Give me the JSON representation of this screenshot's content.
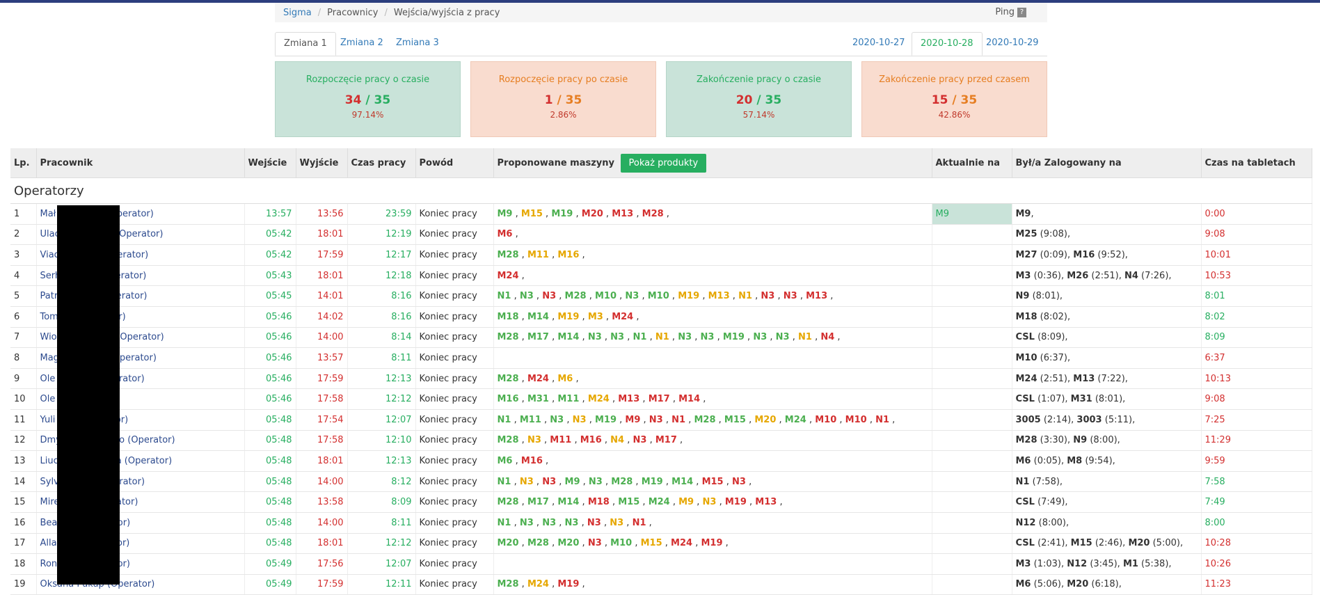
{
  "breadcrumb": {
    "items": [
      "Sigma",
      "Pracownicy",
      "Wejścia/wyjścia z pracy"
    ],
    "ping": "Ping",
    "ping_q": "?"
  },
  "tabs": {
    "shifts": [
      "Zmiana 1",
      "Zmiana 2",
      "Zmiana 3"
    ],
    "dates": [
      "2020-10-27",
      "2020-10-28",
      "2020-10-29"
    ]
  },
  "stats": [
    {
      "title": "Rozpoczęcie pracy o czasie",
      "num": "34",
      "sep": " / ",
      "total": "35",
      "pct": "97.14%"
    },
    {
      "title": "Rozpoczęcie pracy po czasie",
      "num": "1",
      "sep": " / ",
      "total": "35",
      "pct": "2.86%"
    },
    {
      "title": "Zakończenie pracy o czasie",
      "num": "20",
      "sep": " / ",
      "total": "35",
      "pct": "57.14%"
    },
    {
      "title": "Zakończenie pracy przed czasem",
      "num": "15",
      "sep": " / ",
      "total": "35",
      "pct": "42.86%"
    }
  ],
  "table": {
    "headers": [
      "Lp.",
      "Pracownik",
      "Wejście",
      "Wyjście",
      "Czas pracy",
      "Powód",
      "Proponowane maszyny",
      "Aktualnie na",
      "Był/a Zalogowany na",
      "Czas na tabletach"
    ],
    "button": "Pokaż produkty",
    "group": "Operatorzy",
    "rows": [
      {
        "lp": "1",
        "emp": "Mał",
        "emp2": "a (Operator)",
        "in": "13:57",
        "out": "13:56",
        "time": "23:59",
        "reason": "Koniec pracy",
        "m": [
          [
            "M9",
            "g"
          ],
          [
            "M15",
            "y"
          ],
          [
            "M19",
            "g"
          ],
          [
            "M20",
            "r"
          ],
          [
            "M13",
            "r"
          ],
          [
            "M28",
            "r"
          ]
        ],
        "curr": "M9",
        "log": "M9,",
        "tab": "0:00",
        "tabc": "red"
      },
      {
        "lp": "2",
        "emp": "Ulac",
        "emp2": "da (Operator)",
        "in": "05:42",
        "out": "18:01",
        "time": "12:19",
        "reason": "Koniec pracy",
        "m": [
          [
            "M6",
            "r"
          ]
        ],
        "curr": "",
        "log": "M25 (9:08),",
        "tab": "9:08",
        "tabc": "red"
      },
      {
        "lp": "3",
        "emp": "Viac",
        "emp2": "(Operator)",
        "in": "05:42",
        "out": "17:59",
        "time": "12:17",
        "reason": "Koniec pracy",
        "m": [
          [
            "M28",
            "g"
          ],
          [
            "M11",
            "y"
          ],
          [
            "M16",
            "y"
          ]
        ],
        "curr": "",
        "log": "M27 (0:09), M16 (9:52),",
        "tab": "10:01",
        "tabc": "red"
      },
      {
        "lp": "4",
        "emp": "Serh",
        "emp2": "Operator)",
        "in": "05:43",
        "out": "18:01",
        "time": "12:18",
        "reason": "Koniec pracy",
        "m": [
          [
            "M24",
            "r"
          ]
        ],
        "curr": "",
        "log": "M3 (0:36), M26 (2:51), N4 (7:26),",
        "tab": "10:53",
        "tabc": "red"
      },
      {
        "lp": "5",
        "emp": "Patr",
        "emp2": "(Operator)",
        "in": "05:45",
        "out": "14:01",
        "time": "8:16",
        "reason": "Koniec pracy",
        "m": [
          [
            "N1",
            "g"
          ],
          [
            "N3",
            "g"
          ],
          [
            "N3",
            "r"
          ],
          [
            "M28",
            "g"
          ],
          [
            "M10",
            "g"
          ],
          [
            "N3",
            "g"
          ],
          [
            "M10",
            "g"
          ],
          [
            "M19",
            "y"
          ],
          [
            "M13",
            "y"
          ],
          [
            "N1",
            "y"
          ],
          [
            "N3",
            "r"
          ],
          [
            "N3",
            "r"
          ],
          [
            "M13",
            "r"
          ]
        ],
        "curr": "",
        "log": "N9 (8:01),",
        "tab": "8:01",
        "tabc": "grn"
      },
      {
        "lp": "6",
        "emp": "Tom",
        "emp2": "rator)",
        "in": "05:46",
        "out": "14:02",
        "time": "8:16",
        "reason": "Koniec pracy",
        "m": [
          [
            "M18",
            "g"
          ],
          [
            "M14",
            "g"
          ],
          [
            "M19",
            "y"
          ],
          [
            "M3",
            "y"
          ],
          [
            "M24",
            "r"
          ]
        ],
        "curr": "",
        "log": "M18 (8:02),",
        "tab": "8:02",
        "tabc": "grn"
      },
      {
        "lp": "7",
        "emp": "Wio",
        "emp2": "ura (Operator)",
        "in": "05:46",
        "out": "14:00",
        "time": "8:14",
        "reason": "Koniec pracy",
        "m": [
          [
            "M28",
            "g"
          ],
          [
            "M17",
            "g"
          ],
          [
            "M14",
            "g"
          ],
          [
            "N3",
            "g"
          ],
          [
            "N3",
            "g"
          ],
          [
            "N1",
            "g"
          ],
          [
            "N1",
            "y"
          ],
          [
            "N3",
            "g"
          ],
          [
            "N3",
            "g"
          ],
          [
            "M19",
            "g"
          ],
          [
            "N3",
            "g"
          ],
          [
            "N3",
            "g"
          ],
          [
            "N1",
            "y"
          ],
          [
            "N4",
            "r"
          ]
        ],
        "curr": "",
        "log": "CSL (8:09),",
        "tab": "8:09",
        "tabc": "grn"
      },
      {
        "lp": "8",
        "emp": "Mag",
        "emp2": "k (Operator)",
        "in": "05:46",
        "out": "13:57",
        "time": "8:11",
        "reason": "Koniec pracy",
        "m": [],
        "curr": "",
        "log": "M10 (6:37),",
        "tab": "6:37",
        "tabc": "red"
      },
      {
        "lp": "9",
        "emp": "Ole",
        "emp2": "(Operator)",
        "in": "05:46",
        "out": "17:59",
        "time": "12:13",
        "reason": "Koniec pracy",
        "m": [
          [
            "M28",
            "g"
          ],
          [
            "M24",
            "r"
          ],
          [
            "M6",
            "y"
          ]
        ],
        "curr": "",
        "log": "M24 (2:51), M13 (7:22),",
        "tab": "10:13",
        "tabc": "red"
      },
      {
        "lp": "10",
        "emp": "Ole",
        "emp2": "tor)",
        "in": "05:46",
        "out": "17:58",
        "time": "12:12",
        "reason": "Koniec pracy",
        "m": [
          [
            "M16",
            "g"
          ],
          [
            "M31",
            "g"
          ],
          [
            "M11",
            "g"
          ],
          [
            "M24",
            "y"
          ],
          [
            "M13",
            "r"
          ],
          [
            "M17",
            "r"
          ],
          [
            "M14",
            "r"
          ]
        ],
        "curr": "",
        "log": "CSL (1:07), M31 (8:01),",
        "tab": "9:08",
        "tabc": "red"
      },
      {
        "lp": "11",
        "emp": "Yuli",
        "emp2": "erator)",
        "in": "05:48",
        "out": "17:54",
        "time": "12:07",
        "reason": "Koniec pracy",
        "m": [
          [
            "N1",
            "g"
          ],
          [
            "M11",
            "g"
          ],
          [
            "N3",
            "g"
          ],
          [
            "N3",
            "y"
          ],
          [
            "M19",
            "g"
          ],
          [
            "M9",
            "r"
          ],
          [
            "N3",
            "r"
          ],
          [
            "N1",
            "r"
          ],
          [
            "M28",
            "g"
          ],
          [
            "M15",
            "g"
          ],
          [
            "M20",
            "y"
          ],
          [
            "M24",
            "g"
          ],
          [
            "M10",
            "r"
          ],
          [
            "M10",
            "r"
          ],
          [
            "N1",
            "r"
          ]
        ],
        "curr": "",
        "log": "3005 (2:14), 3003 (5:11),",
        "tab": "7:25",
        "tabc": "red"
      },
      {
        "lp": "12",
        "emp": "Dmy",
        "emp2": "enko (Operator)",
        "in": "05:48",
        "out": "17:58",
        "time": "12:10",
        "reason": "Koniec pracy",
        "m": [
          [
            "M28",
            "g"
          ],
          [
            "N3",
            "y"
          ],
          [
            "M11",
            "r"
          ],
          [
            "M16",
            "r"
          ],
          [
            "N4",
            "y"
          ],
          [
            "N3",
            "r"
          ],
          [
            "M17",
            "r"
          ]
        ],
        "curr": "",
        "log": "M28 (3:30), N9 (8:00),",
        "tab": "11:29",
        "tabc": "red"
      },
      {
        "lp": "13",
        "emp": "Liuc",
        "emp2": "kaya (Operator)",
        "in": "05:48",
        "out": "18:01",
        "time": "12:13",
        "reason": "Koniec pracy",
        "m": [
          [
            "M6",
            "g"
          ],
          [
            "M16",
            "r"
          ]
        ],
        "curr": "",
        "log": "M6 (0:05), M8 (9:54),",
        "tab": "9:59",
        "tabc": "red"
      },
      {
        "lp": "14",
        "emp": "Sylv",
        "emp2": "Operator)",
        "in": "05:48",
        "out": "14:00",
        "time": "8:12",
        "reason": "Koniec pracy",
        "m": [
          [
            "N1",
            "g"
          ],
          [
            "N3",
            "y"
          ],
          [
            "N3",
            "r"
          ],
          [
            "M9",
            "g"
          ],
          [
            "N3",
            "g"
          ],
          [
            "M28",
            "g"
          ],
          [
            "M19",
            "g"
          ],
          [
            "M14",
            "g"
          ],
          [
            "M15",
            "r"
          ],
          [
            "N3",
            "r"
          ]
        ],
        "curr": "",
        "log": "N1 (7:58),",
        "tab": "7:58",
        "tabc": "grn"
      },
      {
        "lp": "15",
        "emp": "Mire",
        "emp2": "perator)",
        "in": "05:48",
        "out": "13:58",
        "time": "8:09",
        "reason": "Koniec pracy",
        "m": [
          [
            "M28",
            "g"
          ],
          [
            "M17",
            "g"
          ],
          [
            "M14",
            "g"
          ],
          [
            "M18",
            "r"
          ],
          [
            "M15",
            "g"
          ],
          [
            "M24",
            "g"
          ],
          [
            "M9",
            "y"
          ],
          [
            "N3",
            "y"
          ],
          [
            "M19",
            "r"
          ],
          [
            "M13",
            "r"
          ]
        ],
        "curr": "",
        "log": "CSL (7:49),",
        "tab": "7:49",
        "tabc": "grn"
      },
      {
        "lp": "16",
        "emp": "Bea",
        "emp2": "erator)",
        "in": "05:48",
        "out": "14:00",
        "time": "8:11",
        "reason": "Koniec pracy",
        "m": [
          [
            "N1",
            "g"
          ],
          [
            "N3",
            "g"
          ],
          [
            "N3",
            "g"
          ],
          [
            "N3",
            "g"
          ],
          [
            "N3",
            "r"
          ],
          [
            "N3",
            "y"
          ],
          [
            "N1",
            "r"
          ]
        ],
        "curr": "",
        "log": "N12 (8:00),",
        "tab": "8:00",
        "tabc": "grn"
      },
      {
        "lp": "17",
        "emp": "Alla",
        "emp2": "erator)",
        "in": "05:48",
        "out": "18:01",
        "time": "12:12",
        "reason": "Koniec pracy",
        "m": [
          [
            "M20",
            "g"
          ],
          [
            "M28",
            "g"
          ],
          [
            "M20",
            "g"
          ],
          [
            "N3",
            "r"
          ],
          [
            "M10",
            "g"
          ],
          [
            "M15",
            "y"
          ],
          [
            "M24",
            "r"
          ],
          [
            "M19",
            "r"
          ]
        ],
        "curr": "",
        "log": "CSL (2:41), M15 (2:46), M20 (5:00),",
        "tab": "10:28",
        "tabc": "red"
      },
      {
        "lp": "18",
        "emp": "Ron",
        "emp2": "erator)",
        "in": "05:49",
        "out": "17:56",
        "time": "12:07",
        "reason": "Koniec pracy",
        "m": [],
        "curr": "",
        "log": "M3 (1:03), N12 (3:45), M1 (5:38),",
        "tab": "10:26",
        "tabc": "red"
      },
      {
        "lp": "19",
        "emp": "Oksana Pukup (Operator)",
        "emp2": "",
        "in": "05:49",
        "out": "17:59",
        "time": "12:11",
        "reason": "Koniec pracy",
        "m": [
          [
            "M28",
            "g"
          ],
          [
            "M24",
            "y"
          ],
          [
            "M19",
            "r"
          ]
        ],
        "curr": "",
        "log": "M6 (5:06), M20 (6:18),",
        "tab": "11:23",
        "tabc": "red"
      }
    ]
  }
}
